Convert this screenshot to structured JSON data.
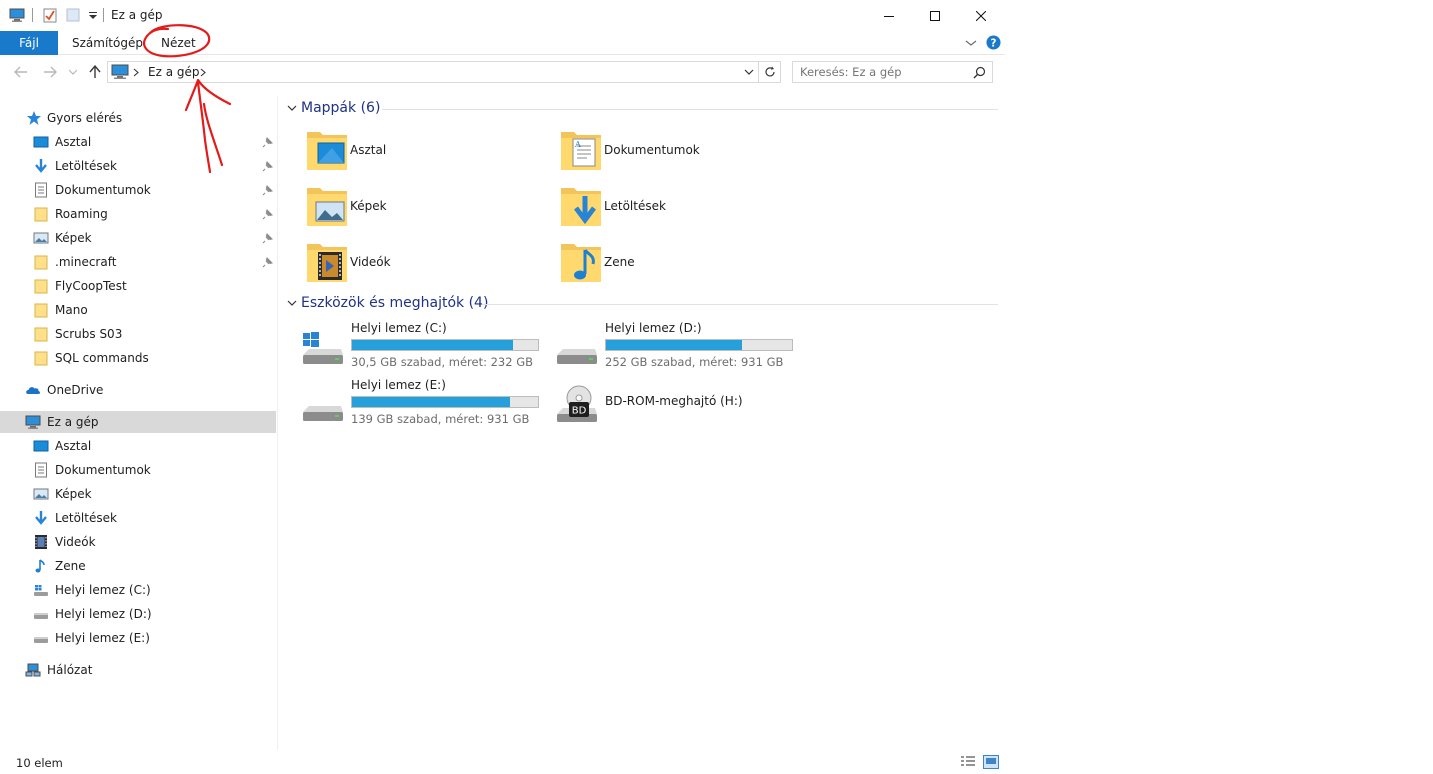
{
  "window": {
    "title": "Ez a gép",
    "buttons": {
      "minimize": "minimize-icon",
      "maximize": "maximize-icon",
      "close": "close-icon"
    }
  },
  "ribbon": {
    "tabs": [
      {
        "label": "Fájl"
      },
      {
        "label": "Számítógép"
      },
      {
        "label": "Nézet"
      }
    ]
  },
  "address": {
    "segments": [
      "Ez a gép"
    ]
  },
  "search": {
    "placeholder": "Keresés: Ez a gép"
  },
  "nav": {
    "quick_access": {
      "label": "Gyors elérés",
      "items": [
        {
          "label": "Asztal",
          "icon": "desktop-icon",
          "pinned": true
        },
        {
          "label": "Letöltések",
          "icon": "download-icon",
          "pinned": true
        },
        {
          "label": "Dokumentumok",
          "icon": "document-icon",
          "pinned": true
        },
        {
          "label": "Roaming",
          "icon": "folder-icon",
          "pinned": true
        },
        {
          "label": "Képek",
          "icon": "pictures-icon",
          "pinned": true
        },
        {
          "label": ".minecraft",
          "icon": "folder-icon",
          "pinned": true
        },
        {
          "label": "FlyCoopTest",
          "icon": "folder-icon",
          "pinned": false
        },
        {
          "label": "Mano",
          "icon": "folder-icon",
          "pinned": false
        },
        {
          "label": "Scrubs S03",
          "icon": "folder-icon",
          "pinned": false
        },
        {
          "label": "SQL commands",
          "icon": "folder-icon",
          "pinned": false
        }
      ]
    },
    "onedrive": {
      "label": "OneDrive"
    },
    "this_pc": {
      "label": "Ez a gép",
      "items": [
        {
          "label": "Asztal",
          "icon": "desktop-icon"
        },
        {
          "label": "Dokumentumok",
          "icon": "document-icon"
        },
        {
          "label": "Képek",
          "icon": "pictures-icon"
        },
        {
          "label": "Letöltések",
          "icon": "download-icon"
        },
        {
          "label": "Videók",
          "icon": "video-icon"
        },
        {
          "label": "Zene",
          "icon": "music-icon"
        },
        {
          "label": "Helyi lemez (C:)",
          "icon": "windows-drive-icon"
        },
        {
          "label": "Helyi lemez (D:)",
          "icon": "drive-icon"
        },
        {
          "label": "Helyi lemez (E:)",
          "icon": "drive-icon"
        }
      ]
    },
    "network": {
      "label": "Hálózat"
    }
  },
  "content": {
    "folders_header": "Mappák (6)",
    "folders": [
      {
        "label": "Asztal",
        "overlay": "desktop"
      },
      {
        "label": "Dokumentumok",
        "overlay": "document"
      },
      {
        "label": "Képek",
        "overlay": "pictures"
      },
      {
        "label": "Letöltések",
        "overlay": "download"
      },
      {
        "label": "Videók",
        "overlay": "video"
      },
      {
        "label": "Zene",
        "overlay": "music"
      }
    ],
    "drives_header": "Eszközök és meghajtók (4)",
    "drives": [
      {
        "name": "Helyi lemez (C:)",
        "free_text": "30,5 GB szabad, méret: 232 GB",
        "used_fraction": 0.868,
        "icon": "windows-drive-icon"
      },
      {
        "name": "Helyi lemez (D:)",
        "free_text": "252 GB szabad, méret: 931 GB",
        "used_fraction": 0.729,
        "icon": "drive-icon"
      },
      {
        "name": "Helyi lemez (E:)",
        "free_text": "139 GB szabad, méret: 931 GB",
        "used_fraction": 0.851,
        "icon": "drive-icon"
      },
      {
        "name": "BD-ROM-meghajtó (H:)",
        "icon": "bd-rom-icon",
        "disc_label": "BD"
      }
    ]
  },
  "status": {
    "count": "10 elem"
  },
  "colors": {
    "accent": "#1979ca",
    "selection": "#d9d9d9",
    "bar": "#26a0da",
    "section_title": "#1e3287",
    "annotation": "#e31b1b"
  }
}
